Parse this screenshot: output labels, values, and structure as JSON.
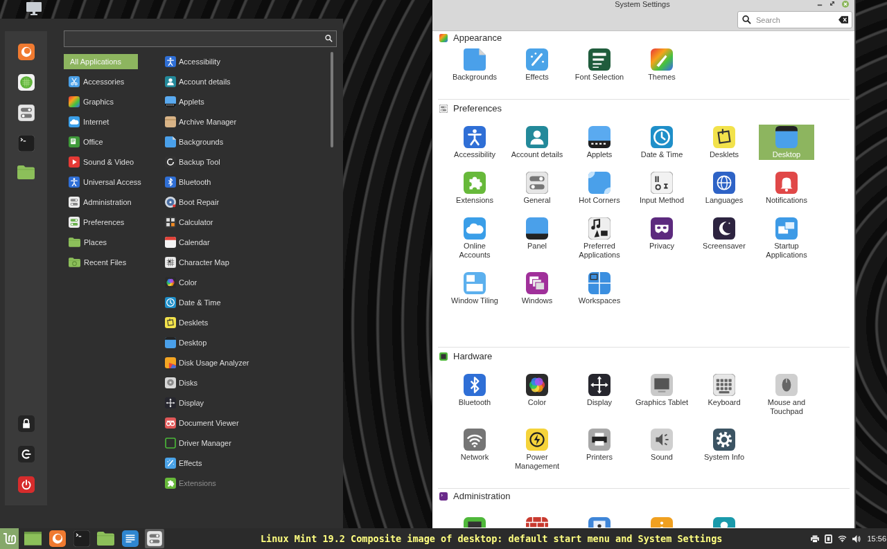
{
  "menu": {
    "categories": [
      {
        "label": "All Applications",
        "selected": true
      },
      {
        "label": "Accessories",
        "selected": false
      },
      {
        "label": "Graphics",
        "selected": false
      },
      {
        "label": "Internet",
        "selected": false
      },
      {
        "label": "Office",
        "selected": false
      },
      {
        "label": "Sound & Video",
        "selected": false
      },
      {
        "label": "Universal Access",
        "selected": false
      },
      {
        "label": "Administration",
        "selected": false
      },
      {
        "label": "Preferences",
        "selected": false
      },
      {
        "label": "Places",
        "selected": false
      },
      {
        "label": "Recent Files",
        "selected": false
      }
    ],
    "applications": [
      "Accessibility",
      "Account details",
      "Applets",
      "Archive Manager",
      "Backgrounds",
      "Backup Tool",
      "Bluetooth",
      "Boot Repair",
      "Calculator",
      "Calendar",
      "Character Map",
      "Color",
      "Date & Time",
      "Desklets",
      "Desktop",
      "Disk Usage Analyzer",
      "Disks",
      "Display",
      "Document Viewer",
      "Driver Manager",
      "Effects",
      "Extensions"
    ]
  },
  "settings_window": {
    "title": "System Settings",
    "search": {
      "placeholder": "Search"
    },
    "sections": [
      {
        "title": "Appearance",
        "items": [
          {
            "label": "Backgrounds",
            "selected": false
          },
          {
            "label": "Effects",
            "selected": false
          },
          {
            "label": "Font Selection",
            "selected": false
          },
          {
            "label": "Themes",
            "selected": false
          }
        ]
      },
      {
        "title": "Preferences",
        "items": [
          {
            "label": "Accessibility",
            "selected": false
          },
          {
            "label": "Account details",
            "selected": false
          },
          {
            "label": "Applets",
            "selected": false
          },
          {
            "label": "Date & Time",
            "selected": false
          },
          {
            "label": "Desklets",
            "selected": false
          },
          {
            "label": "Desktop",
            "selected": true
          },
          {
            "label": "Extensions",
            "selected": false
          },
          {
            "label": "General",
            "selected": false
          },
          {
            "label": "Hot Corners",
            "selected": false
          },
          {
            "label": "Input Method",
            "selected": false
          },
          {
            "label": "Languages",
            "selected": false
          },
          {
            "label": "Notifications",
            "selected": false
          },
          {
            "label": "Online\nAccounts",
            "selected": false
          },
          {
            "label": "Panel",
            "selected": false
          },
          {
            "label": "Preferred\nApplications",
            "selected": false
          },
          {
            "label": "Privacy",
            "selected": false
          },
          {
            "label": "Screensaver",
            "selected": false
          },
          {
            "label": "Startup\nApplications",
            "selected": false
          },
          {
            "label": "Window Tiling",
            "selected": false
          },
          {
            "label": "Windows",
            "selected": false
          },
          {
            "label": "Workspaces",
            "selected": false
          }
        ]
      },
      {
        "title": "Hardware",
        "items": [
          {
            "label": "Bluetooth",
            "selected": false
          },
          {
            "label": "Color",
            "selected": false
          },
          {
            "label": "Display",
            "selected": false
          },
          {
            "label": "Graphics Tablet",
            "selected": false
          },
          {
            "label": "Keyboard",
            "selected": false
          },
          {
            "label": "Mouse and\nTouchpad",
            "selected": false
          },
          {
            "label": "Network",
            "selected": false
          },
          {
            "label": "Power\nManagement",
            "selected": false
          },
          {
            "label": "Printers",
            "selected": false
          },
          {
            "label": "Sound",
            "selected": false
          },
          {
            "label": "System Info",
            "selected": false
          }
        ]
      },
      {
        "title": "Administration"
      }
    ]
  },
  "taskbar": {
    "menu_open": true,
    "buttons": [
      {
        "selected": false
      },
      {
        "selected": false
      },
      {
        "selected": false
      },
      {
        "selected": false
      },
      {
        "selected": false
      },
      {
        "selected": true
      }
    ],
    "clock": "15:56"
  },
  "caption": "Linux Mint 19.2 Composite image of desktop: default start menu and System Settings"
}
